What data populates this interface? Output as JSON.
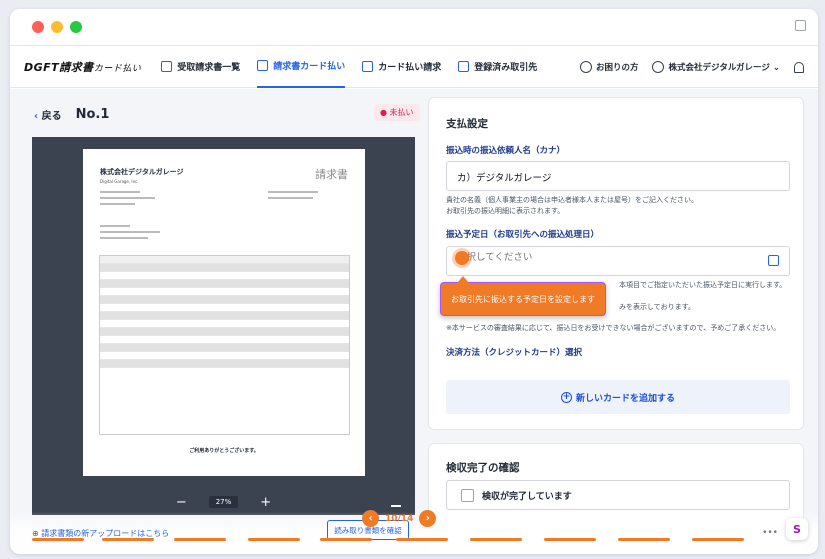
{
  "window": {
    "dots": [
      "#ff5f57",
      "#febc2e",
      "#28c840"
    ]
  },
  "nav": {
    "logo": "DGFT請求書",
    "logo_sub": "カード払い",
    "items": [
      {
        "label": "受取請求書一覧",
        "icon": "document-icon"
      },
      {
        "label": "請求書カード払い",
        "icon": "credit-card-icon",
        "active": true
      },
      {
        "label": "カード払い請求",
        "icon": "mail-icon"
      },
      {
        "label": "登録済み取引先",
        "icon": "building-icon"
      }
    ],
    "help": "お困りの方",
    "account": "株式会社デジタルガレージ"
  },
  "left": {
    "back": "戻る",
    "number": "No.1",
    "status": "未払い",
    "invoice": {
      "company": "株式会社デジタルガレージ",
      "company_en": "Digital Garage, Inc.",
      "title": "請求書",
      "footer": "ご利用ありがとうございます。"
    },
    "zoom": "27%"
  },
  "payment": {
    "heading": "支払設定",
    "payer_label": "振込時の振込依頼人名（カナ）",
    "payer_value": "カ）デジタルガレージ",
    "payer_help1": "貴社の名義（個人事業主の場合は申込者様本人または屋号）をご記入ください。",
    "payer_help2": "お取引先の振込明細に表示されます。",
    "date_label": "振込予定日（お取引先への振込処理日）",
    "date_placeholder": "選択してください",
    "date_help1": "本項目でご指定いただいた振込予定日に実行します。",
    "date_help2": "みを表示しております。",
    "date_help3": "※本サービスの審査結果に応じて、振込日をお受けできない場合がございますので、予めご了承ください。",
    "method_label": "決済方法（クレジットカード）選択",
    "add_card": "新しいカードを追加する"
  },
  "inspection": {
    "heading": "検収完了の確認",
    "checkbox_label": "検収が完了しています"
  },
  "tooltip": "お取引先に振込する予定日を設定します",
  "bottom": {
    "upload_link": "請求書類の新アップロードはこちら",
    "pager": "10/14",
    "outline_button": "読み取り書類を確認"
  }
}
